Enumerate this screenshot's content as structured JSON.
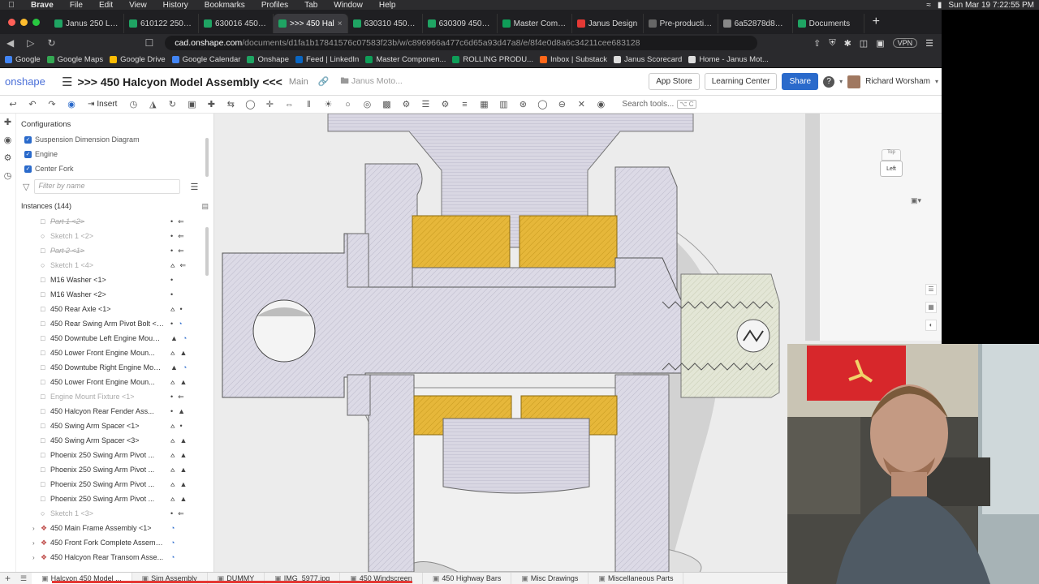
{
  "menubar": {
    "app": "Brave",
    "items": [
      "File",
      "Edit",
      "View",
      "History",
      "Bookmarks",
      "Profiles",
      "Tab",
      "Window",
      "Help"
    ],
    "clock": "Sun Mar 19  7:22:55 PM"
  },
  "browser": {
    "tabs": [
      {
        "label": "Janus 250 Leadi",
        "color": "#1fa463"
      },
      {
        "label": "610122 250 Fork",
        "color": "#1fa463"
      },
      {
        "label": "630016 450 Fork",
        "color": "#1fa463"
      },
      {
        "label": ">>> 450 Hal",
        "color": "#1fa463",
        "active": true
      },
      {
        "label": "630310 450 Eng",
        "color": "#1fa463"
      },
      {
        "label": "630309 450 Eng",
        "color": "#1fa463"
      },
      {
        "label": "Master Compone",
        "color": "#0f9d58"
      },
      {
        "label": "Janus Design",
        "color": "#e53935"
      },
      {
        "label": "Pre-production-",
        "color": "#666666"
      },
      {
        "label": "6a52878d8898",
        "color": "#888888"
      },
      {
        "label": "Documents",
        "color": "#1fa463"
      }
    ],
    "url_host": "cad.onshape.com",
    "url_path": "/documents/d1fa1b17841576c07583f23b/w/c896966a477c6d65a93d47a8/e/8f4e0d8a6c34211cee683128",
    "vpn": "VPN",
    "bookmarks": [
      {
        "label": "Google",
        "color": "#4285f4"
      },
      {
        "label": "Google Maps",
        "color": "#34a853"
      },
      {
        "label": "Google Drive",
        "color": "#fbbc04"
      },
      {
        "label": "Google Calendar",
        "color": "#4285f4"
      },
      {
        "label": "Onshape",
        "color": "#1fa463"
      },
      {
        "label": "Feed | LinkedIn",
        "color": "#0a66c2"
      },
      {
        "label": "Master Componen...",
        "color": "#0f9d58"
      },
      {
        "label": "ROLLING PRODU...",
        "color": "#0f9d58"
      },
      {
        "label": "Inbox | Substack",
        "color": "#ff6719"
      },
      {
        "label": "Janus Scorecard",
        "color": "#dddddd"
      },
      {
        "label": "Home - Janus Mot...",
        "color": "#dddddd"
      }
    ]
  },
  "onshape": {
    "logo": "onshape",
    "doc_title": ">>> 450 Halcyon Model Assembly <<<",
    "branch": "Main",
    "folder": "Janus Moto...",
    "app_store": "App Store",
    "learning_center": "Learning Center",
    "share": "Share",
    "user": "Richard Worsham",
    "insert": "Insert",
    "search_tools": "Search tools...",
    "search_kbd": "⌥ C"
  },
  "panel": {
    "configurations_title": "Configurations",
    "configurations": [
      "Suspension Dimension Diagram",
      "Engine",
      "Center Fork"
    ],
    "filter_placeholder": "Filter by name",
    "instances_title": "Instances (144)",
    "instances": [
      {
        "label": "Part 1 <2>",
        "state": "suppressed",
        "icon": "part",
        "flags": [
          "pin",
          "arrow"
        ]
      },
      {
        "label": "Sketch 1 <2>",
        "state": "sketch",
        "icon": "sketch",
        "flags": [
          "pin",
          "arrow"
        ]
      },
      {
        "label": "Part 2 <1>",
        "state": "suppressed",
        "icon": "part",
        "flags": [
          "pin",
          "arrow"
        ]
      },
      {
        "label": "Sketch 1 <4>",
        "state": "sketch",
        "icon": "sketch",
        "flags": [
          "mate",
          "arrow"
        ]
      },
      {
        "label": "M16 Washer <1>",
        "state": "normal",
        "icon": "part",
        "flags": [
          "pin"
        ]
      },
      {
        "label": "M16 Washer <2>",
        "state": "normal",
        "icon": "part",
        "flags": [
          "pin"
        ]
      },
      {
        "label": "450 Rear Axle <1>",
        "state": "normal",
        "icon": "part",
        "flags": [
          "mate",
          "pin"
        ]
      },
      {
        "label": "450 Rear Swing Arm Pivot Bolt <1>",
        "state": "normal",
        "icon": "part",
        "flags": [
          "pin",
          "link"
        ]
      },
      {
        "label": "450 Downtube Left Engine Mount ...",
        "state": "normal",
        "icon": "part",
        "flags": [
          "tri",
          "link"
        ]
      },
      {
        "label": "450 Lower Front Engine Moun...",
        "state": "normal",
        "icon": "part",
        "flags": [
          "mate",
          "tri"
        ]
      },
      {
        "label": "450 Downtube Right Engine Moun...",
        "state": "normal",
        "icon": "part",
        "flags": [
          "tri",
          "link"
        ]
      },
      {
        "label": "450 Lower Front Engine Moun...",
        "state": "normal",
        "icon": "part",
        "flags": [
          "mate",
          "tri"
        ]
      },
      {
        "label": "Engine Mount Fixture <1>",
        "state": "sketch",
        "icon": "part",
        "flags": [
          "pin",
          "arrow"
        ]
      },
      {
        "label": "450 Halcyon Rear Fender Ass...",
        "state": "normal",
        "icon": "part",
        "flags": [
          "pin",
          "tri"
        ]
      },
      {
        "label": "450 Swing Arm Spacer <1>",
        "state": "normal",
        "icon": "part",
        "flags": [
          "mate",
          "pin"
        ]
      },
      {
        "label": "450 Swing Arm Spacer <3>",
        "state": "normal",
        "icon": "part",
        "flags": [
          "mate",
          "tri"
        ]
      },
      {
        "label": "Phoenix 250 Swing Arm Pivot ...",
        "state": "normal",
        "icon": "part",
        "flags": [
          "mate",
          "tri"
        ]
      },
      {
        "label": "Phoenix 250 Swing Arm Pivot ...",
        "state": "normal",
        "icon": "part",
        "flags": [
          "mate",
          "tri"
        ]
      },
      {
        "label": "Phoenix 250 Swing Arm Pivot ...",
        "state": "normal",
        "icon": "part",
        "flags": [
          "mate",
          "tri"
        ]
      },
      {
        "label": "Phoenix 250 Swing Arm Pivot ...",
        "state": "normal",
        "icon": "part",
        "flags": [
          "mate",
          "tri"
        ]
      },
      {
        "label": "Sketch 1 <3>",
        "state": "sketch",
        "icon": "sketch",
        "flags": [
          "pin",
          "arrow"
        ]
      },
      {
        "label": "450 Main Frame Assembly <1>",
        "state": "normal",
        "icon": "assembly",
        "flags": [
          "link"
        ],
        "expandable": true
      },
      {
        "label": "450 Front Fork Complete Assemb...",
        "state": "normal",
        "icon": "assembly",
        "flags": [
          "link"
        ],
        "expandable": true
      },
      {
        "label": "450 Halcyon Rear Transom Asse...",
        "state": "normal",
        "icon": "assembly",
        "flags": [
          "link"
        ],
        "expandable": true
      }
    ]
  },
  "viewcube": {
    "face": "Left",
    "top_face": "Top"
  },
  "bottom_tabs": [
    {
      "label": "Halcyon 450 Model ...",
      "active": true
    },
    {
      "label": "Sim Assembly"
    },
    {
      "label": "DUMMY"
    },
    {
      "label": "IMG_5977.jpg"
    },
    {
      "label": "450 Windscreen"
    },
    {
      "label": "450 Highway Bars"
    },
    {
      "label": "Misc Drawings"
    },
    {
      "label": "Miscellaneous Parts"
    }
  ],
  "colors": {
    "accent": "#2a6acb",
    "gold": "#e0b52e",
    "steel": "#d8d6e2",
    "hatch": "#c9c7d4"
  }
}
